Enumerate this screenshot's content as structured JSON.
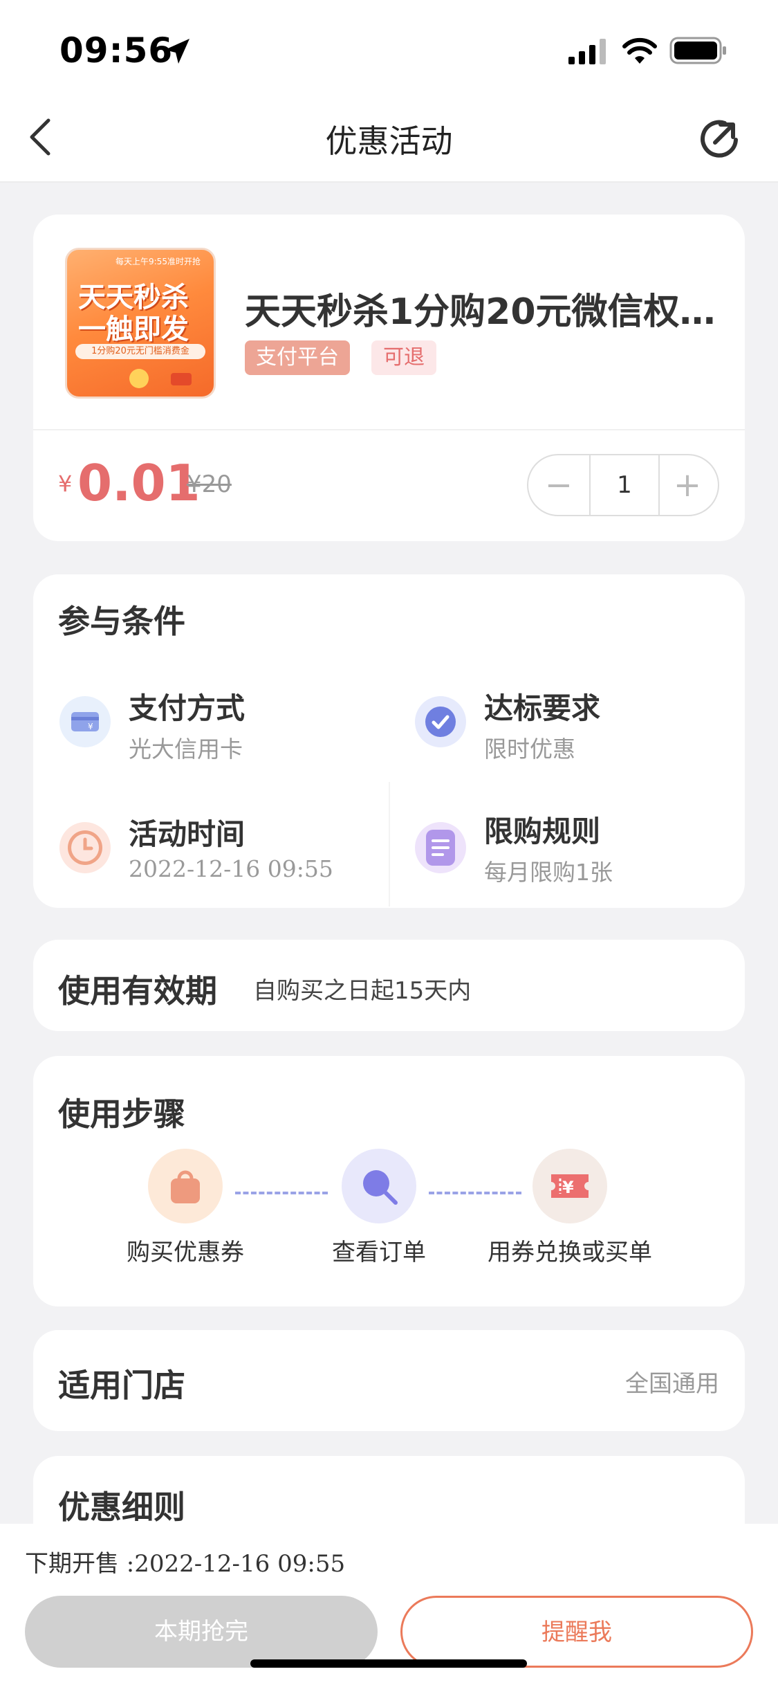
{
  "status": {
    "time": "09:56"
  },
  "nav": {
    "title": "优惠活动"
  },
  "product": {
    "title": "天天秒杀1分购20元微信权…",
    "image_text": {
      "line1": "天天秒杀",
      "line2": "一触即发",
      "banner": "1分购20元无门槛消费金",
      "corner": "每天上午9:55准时开抢"
    },
    "tags": [
      "支付平台",
      "可退"
    ],
    "currency": "¥",
    "price": "0.01",
    "original_price": "¥20",
    "quantity": "1",
    "minus": "−",
    "plus": "+"
  },
  "conditions": {
    "heading": "参与条件",
    "items": [
      {
        "title": "支付方式",
        "sub": "光大信用卡",
        "icon": "card-icon"
      },
      {
        "title": "达标要求",
        "sub": "限时优惠",
        "icon": "check-icon"
      },
      {
        "title": "活动时间",
        "sub": "2022-12-16 09:55",
        "icon": "clock-icon"
      },
      {
        "title": "限购规则",
        "sub": "每月限购1张",
        "icon": "document-icon"
      }
    ]
  },
  "validity": {
    "heading": "使用有效期",
    "value": "自购买之日起15天内"
  },
  "steps": {
    "heading": "使用步骤",
    "items": [
      {
        "label": "购买优惠券",
        "icon": "bag-icon"
      },
      {
        "label": "查看订单",
        "icon": "search-icon"
      },
      {
        "label": "用券兑换或买单",
        "icon": "ticket-icon"
      }
    ]
  },
  "stores": {
    "heading": "适用门店",
    "value": "全国通用"
  },
  "details": {
    "heading": "优惠细则"
  },
  "footer": {
    "next_sale": "下期开售 :2022-12-16 09:55",
    "sold_out": "本期抢完",
    "remind": "提醒我"
  },
  "colors": {
    "accent": "#e56d6d",
    "remind": "#eb7a5a",
    "tag_bg": "#eda595"
  }
}
